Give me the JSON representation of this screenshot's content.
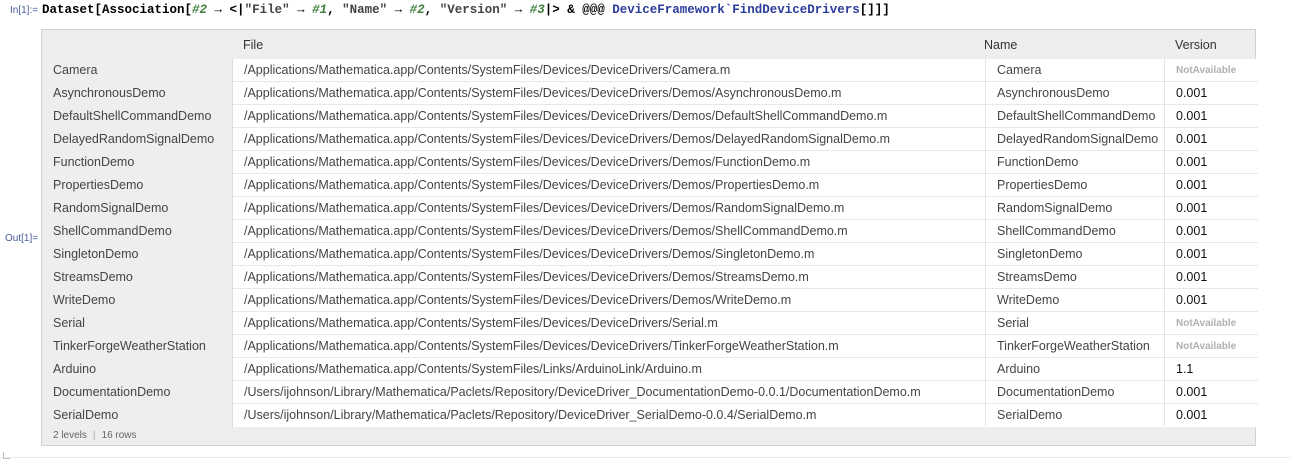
{
  "cell": {
    "in_label": "In[1]:=",
    "out_label": "Out[1]=",
    "input": {
      "p1": "Dataset[Association[",
      "s1": "#2",
      "p2": " → <|",
      "str1": "\"File\"",
      "p3": " → ",
      "s2": "#1",
      "p4": ", ",
      "str2": "\"Name\"",
      "p5": " → ",
      "s3": "#2",
      "p6": ", ",
      "str3": "\"Version\"",
      "p7": " → ",
      "s4": "#3",
      "p8": "|> & @@@ ",
      "sym": "DeviceFramework`FindDeviceDrivers",
      "p9": "[]]]"
    }
  },
  "dataset": {
    "headers": {
      "file": "File",
      "name": "Name",
      "version": "Version"
    },
    "rows": [
      {
        "key": "Camera",
        "file": "/Applications/Mathematica.app/Contents/SystemFiles/Devices/DeviceDrivers/Camera.m",
        "name": "Camera",
        "version": "NotAvailable",
        "na": true
      },
      {
        "key": "AsynchronousDemo",
        "file": "/Applications/Mathematica.app/Contents/SystemFiles/Devices/DeviceDrivers/Demos/AsynchronousDemo.m",
        "name": "AsynchronousDemo",
        "version": "0.001",
        "na": false
      },
      {
        "key": "DefaultShellCommandDemo",
        "file": "/Applications/Mathematica.app/Contents/SystemFiles/Devices/DeviceDrivers/Demos/DefaultShellCommandDemo.m",
        "name": "DefaultShellCommandDemo",
        "version": "0.001",
        "na": false
      },
      {
        "key": "DelayedRandomSignalDemo",
        "file": "/Applications/Mathematica.app/Contents/SystemFiles/Devices/DeviceDrivers/Demos/DelayedRandomSignalDemo.m",
        "name": "DelayedRandomSignalDemo",
        "version": "0.001",
        "na": false
      },
      {
        "key": "FunctionDemo",
        "file": "/Applications/Mathematica.app/Contents/SystemFiles/Devices/DeviceDrivers/Demos/FunctionDemo.m",
        "name": "FunctionDemo",
        "version": "0.001",
        "na": false
      },
      {
        "key": "PropertiesDemo",
        "file": "/Applications/Mathematica.app/Contents/SystemFiles/Devices/DeviceDrivers/Demos/PropertiesDemo.m",
        "name": "PropertiesDemo",
        "version": "0.001",
        "na": false
      },
      {
        "key": "RandomSignalDemo",
        "file": "/Applications/Mathematica.app/Contents/SystemFiles/Devices/DeviceDrivers/Demos/RandomSignalDemo.m",
        "name": "RandomSignalDemo",
        "version": "0.001",
        "na": false
      },
      {
        "key": "ShellCommandDemo",
        "file": "/Applications/Mathematica.app/Contents/SystemFiles/Devices/DeviceDrivers/Demos/ShellCommandDemo.m",
        "name": "ShellCommandDemo",
        "version": "0.001",
        "na": false
      },
      {
        "key": "SingletonDemo",
        "file": "/Applications/Mathematica.app/Contents/SystemFiles/Devices/DeviceDrivers/Demos/SingletonDemo.m",
        "name": "SingletonDemo",
        "version": "0.001",
        "na": false
      },
      {
        "key": "StreamsDemo",
        "file": "/Applications/Mathematica.app/Contents/SystemFiles/Devices/DeviceDrivers/Demos/StreamsDemo.m",
        "name": "StreamsDemo",
        "version": "0.001",
        "na": false
      },
      {
        "key": "WriteDemo",
        "file": "/Applications/Mathematica.app/Contents/SystemFiles/Devices/DeviceDrivers/Demos/WriteDemo.m",
        "name": "WriteDemo",
        "version": "0.001",
        "na": false
      },
      {
        "key": "Serial",
        "file": "/Applications/Mathematica.app/Contents/SystemFiles/Devices/DeviceDrivers/Serial.m",
        "name": "Serial",
        "version": "NotAvailable",
        "na": true
      },
      {
        "key": "TinkerForgeWeatherStation",
        "file": "/Applications/Mathematica.app/Contents/SystemFiles/Devices/DeviceDrivers/TinkerForgeWeatherStation.m",
        "name": "TinkerForgeWeatherStation",
        "version": "NotAvailable",
        "na": true
      },
      {
        "key": "Arduino",
        "file": "/Applications/Mathematica.app/Contents/SystemFiles/Links/ArduinoLink/Arduino.m",
        "name": "Arduino",
        "version": "1.1",
        "na": false
      },
      {
        "key": "DocumentationDemo",
        "file": "/Users/ijohnson/Library/Mathematica/Paclets/Repository/DeviceDriver_DocumentationDemo-0.0.1/DocumentationDemo.m",
        "name": "DocumentationDemo",
        "version": "0.001",
        "na": false
      },
      {
        "key": "SerialDemo",
        "file": "/Users/ijohnson/Library/Mathematica/Paclets/Repository/DeviceDriver_SerialDemo-0.0.4/SerialDemo.m",
        "name": "SerialDemo",
        "version": "0.001",
        "na": false
      }
    ],
    "footer": {
      "levels": "2 levels",
      "separator": "|",
      "rows": "16 rows"
    }
  }
}
